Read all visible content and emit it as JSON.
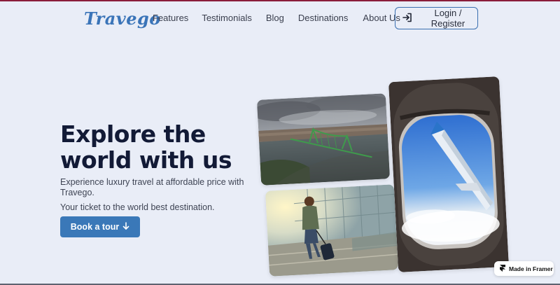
{
  "brand": {
    "logo_text": "Travego",
    "logo_color": "#3a74b8"
  },
  "nav": {
    "items": [
      {
        "label": "Features"
      },
      {
        "label": "Testimonials"
      },
      {
        "label": "Blog"
      },
      {
        "label": "Destinations"
      },
      {
        "label": "About Us"
      }
    ],
    "login_label": "Login / Register",
    "login_icon": "login-arrow-icon"
  },
  "hero": {
    "title": "Explore the world with us",
    "subtitle": "Experience luxury travel at affordable price with Travego.",
    "tagline": "Your ticket to the world best destination.",
    "cta_label": "Book a tour",
    "cta_icon": "arrow-down-icon",
    "cta_color": "#3a78b8"
  },
  "gallery": {
    "images": [
      {
        "name": "bridge-photo"
      },
      {
        "name": "airport-traveler-photo"
      },
      {
        "name": "airplane-window-photo"
      }
    ]
  },
  "badge": {
    "label": "Made in Framer",
    "icon": "framer-logo-icon"
  },
  "colors": {
    "background": "#e9edf7",
    "accent": "#3a78b8",
    "title": "#121a36"
  }
}
